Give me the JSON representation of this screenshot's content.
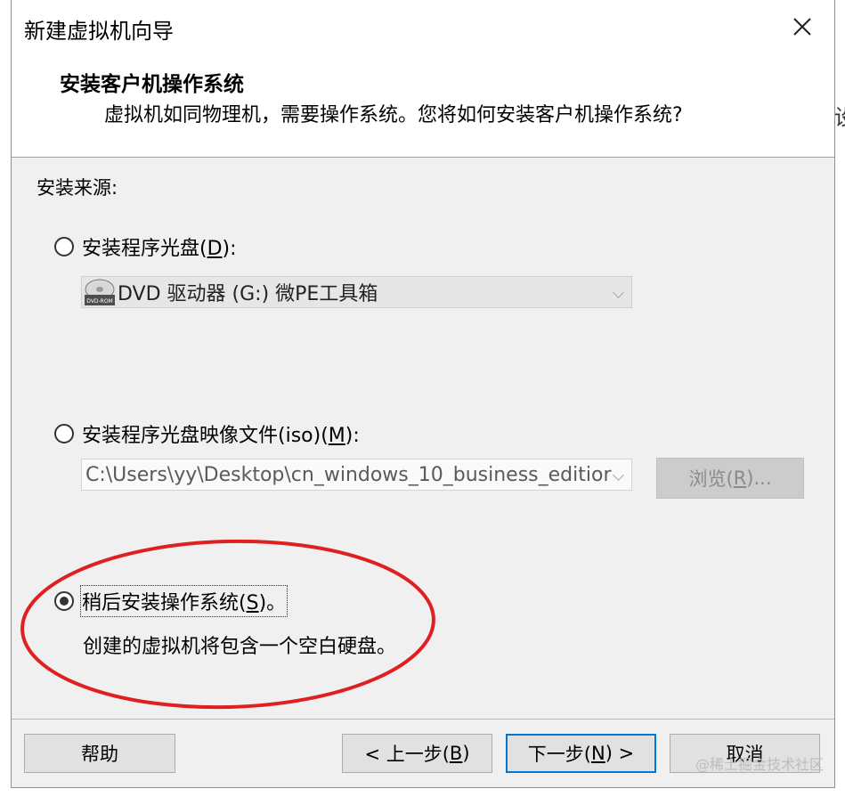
{
  "window": {
    "title": "新建虚拟机向导",
    "close_glyph": "✕"
  },
  "header": {
    "title": "安装客户机操作系统",
    "subtitle": "虚拟机如同物理机，需要操作系统。您将如何安装客户机操作系统?"
  },
  "source_label": "安装来源:",
  "options": {
    "disc": {
      "label_prefix": "安装程序光盘(",
      "mnemonic": "D",
      "label_suffix": "):",
      "selected": false,
      "drive_icon": "dvd-rom-icon",
      "drive_icon_text": "DVD-ROM",
      "drive_value": "DVD 驱动器 (G:) 微PE工具箱"
    },
    "iso": {
      "label_prefix": "安装程序光盘映像文件(iso)(",
      "mnemonic": "M",
      "label_suffix": "):",
      "selected": false,
      "path_value": "C:\\Users\\yy\\Desktop\\cn_windows_10_business_editior",
      "browse_prefix": "浏览(",
      "browse_mnemonic": "R",
      "browse_suffix": ")..."
    },
    "later": {
      "label_prefix": "稍后安装操作系统(",
      "mnemonic": "S",
      "label_suffix": ")。",
      "selected": true,
      "description": "创建的虚拟机将包含一个空白硬盘。"
    }
  },
  "footer": {
    "help": "帮助",
    "back_prefix": "< 上一步(",
    "back_mnemonic": "B",
    "back_suffix": ")",
    "next_prefix": "下一步(",
    "next_mnemonic": "N",
    "next_suffix": ") >",
    "cancel": "取消"
  },
  "side_fragment": "设",
  "watermark": "@稀土掘金技术社区",
  "colors": {
    "annotation_ellipse": "#e02020",
    "default_button_border": "#0078d7"
  }
}
